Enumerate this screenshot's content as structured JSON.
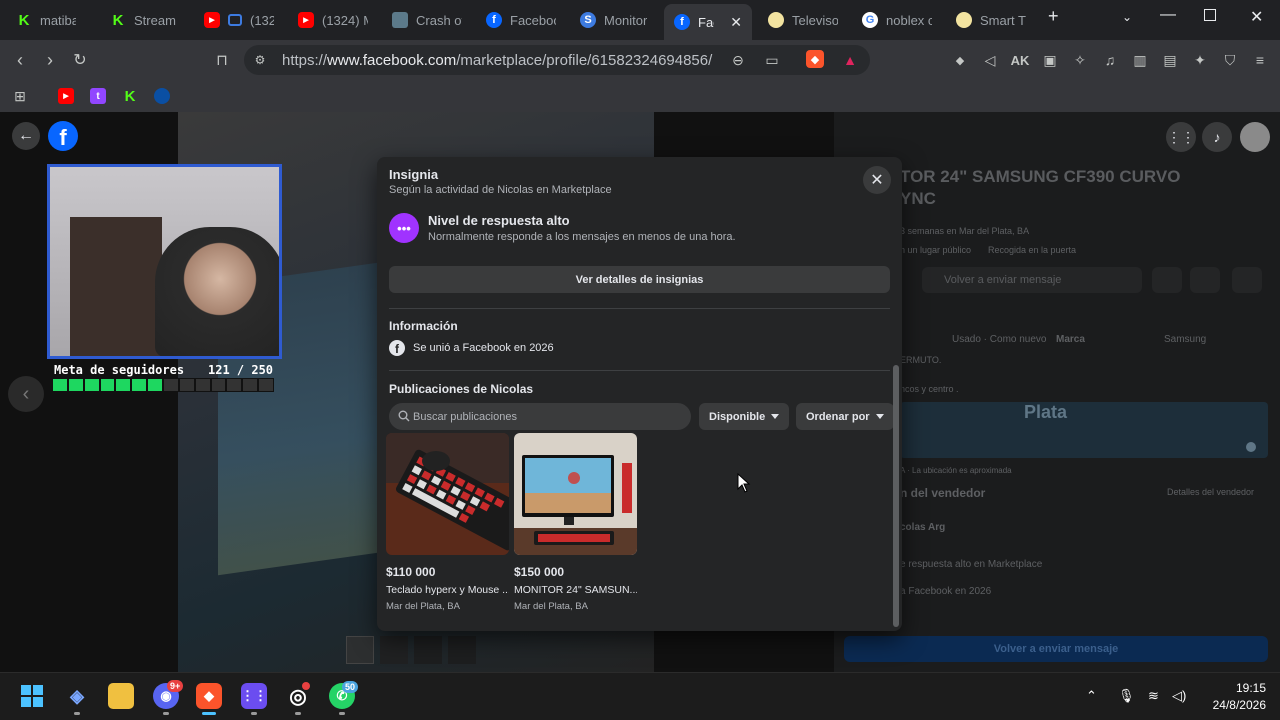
{
  "browser": {
    "tabs": [
      {
        "label": "matibay",
        "icon": "kick-icon",
        "color": "#53fc18"
      },
      {
        "label": "Stream",
        "icon": "kick-icon",
        "color": "#53fc18"
      },
      {
        "label": "(132",
        "icon": "youtube-icon",
        "color": "#ff0000"
      },
      {
        "label": "(1324) M",
        "icon": "youtube-icon",
        "color": "#ff0000"
      },
      {
        "label": "Crash of",
        "icon": "game-icon",
        "color": "#5c7a8a"
      },
      {
        "label": "Faceboo",
        "icon": "facebook-icon",
        "color": "#0866ff"
      },
      {
        "label": "Monitor",
        "icon": "s-icon",
        "color": "#3d7be0"
      },
      {
        "label": "Face",
        "icon": "facebook-icon",
        "color": "#0866ff"
      },
      {
        "label": "Televiso",
        "icon": "brand-icon",
        "color": "#f2e3a0"
      },
      {
        "label": "noblex c",
        "icon": "google-icon",
        "color": "#ffffff"
      },
      {
        "label": "Smart T",
        "icon": "brand-icon",
        "color": "#f2e3a0"
      }
    ],
    "url_prefix": "https://",
    "url_host": "www.facebook.com",
    "url_path": "/marketplace/profile/61582324694856/"
  },
  "stream_overlay": {
    "goal_label": "Meta de seguidores",
    "goal_count": "121 / 250",
    "goal_progress": 0.48
  },
  "background_listing": {
    "title_line1": "TOR 24\" SAMSUNG CF390 CURVO",
    "title_line2": "YNC",
    "posted": "3 semanas en Mar del Plata, BA",
    "meeting": "n un lugar público",
    "pickup": "Recogida en la puerta",
    "send_again": "Volver a enviar mensaje",
    "condition": "Usado · Como nuevo",
    "brand_label": "Marca",
    "brand_value": "Samsung",
    "desc1": "ERMUTO.",
    "desc2": "ncos y centro .",
    "map_label": "Plata",
    "map_note": "A · La ubicación es aproximada",
    "seller_section": "n del vendedor",
    "seller_details": "Detalles del vendedor",
    "seller_name": "colas Arg",
    "seller_response": "e respuesta alto en Marketplace",
    "seller_joined": "a Facebook en 2026",
    "bottom_button": "Volver a enviar mensaje"
  },
  "modal": {
    "title": "Insignia",
    "subtitle": "Según la actividad de Nicolas en Marketplace",
    "badge_title": "Nivel de respuesta alto",
    "badge_desc": "Normalmente responde a los mensajes en menos de una hora.",
    "badge_details_button": "Ver detalles de insignias",
    "info_title": "Información",
    "joined_text": "Se unió a Facebook en 2026",
    "posts_title": "Publicaciones de Nicolas",
    "search_placeholder": "Buscar publicaciones",
    "filter_available": "Disponible",
    "filter_sort": "Ordenar por",
    "listings": [
      {
        "price": "$110 000",
        "title": "Teclado hyperx y Mouse ...",
        "location": "Mar del Plata, BA"
      },
      {
        "price": "$150 000",
        "title": "MONITOR 24\" SAMSUN...",
        "location": "Mar del Plata, BA"
      }
    ]
  },
  "taskbar": {
    "time": "19:15",
    "date": "24/8/2026",
    "discord_badge": "9+",
    "whatsapp_badge": "50"
  }
}
